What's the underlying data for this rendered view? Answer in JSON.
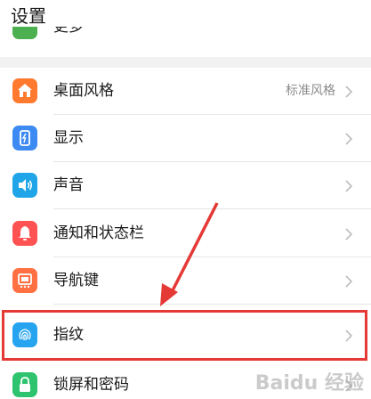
{
  "header": {
    "title": "设置"
  },
  "partial_item": {
    "label": "更多",
    "icon": "more-icon"
  },
  "items": [
    {
      "label": "桌面风格",
      "value": "标准风格",
      "icon": "home-icon",
      "color": "#ff7a2f"
    },
    {
      "label": "显示",
      "value": "",
      "icon": "display-icon",
      "color": "#3d8bf2"
    },
    {
      "label": "声音",
      "value": "",
      "icon": "speaker-icon",
      "color": "#1fa5e8"
    },
    {
      "label": "通知和状态栏",
      "value": "",
      "icon": "bell-icon",
      "color": "#ff5252"
    },
    {
      "label": "导航键",
      "value": "",
      "icon": "navigation-key-icon",
      "color": "#ff7043"
    },
    {
      "label": "指纹",
      "value": "",
      "icon": "fingerprint-icon",
      "color": "#26a4f0"
    },
    {
      "label": "锁屏和密码",
      "value": "",
      "icon": "lock-icon",
      "color": "#2ec46f"
    }
  ],
  "highlight_color": "#e53935",
  "watermark": "Baidu 经验"
}
